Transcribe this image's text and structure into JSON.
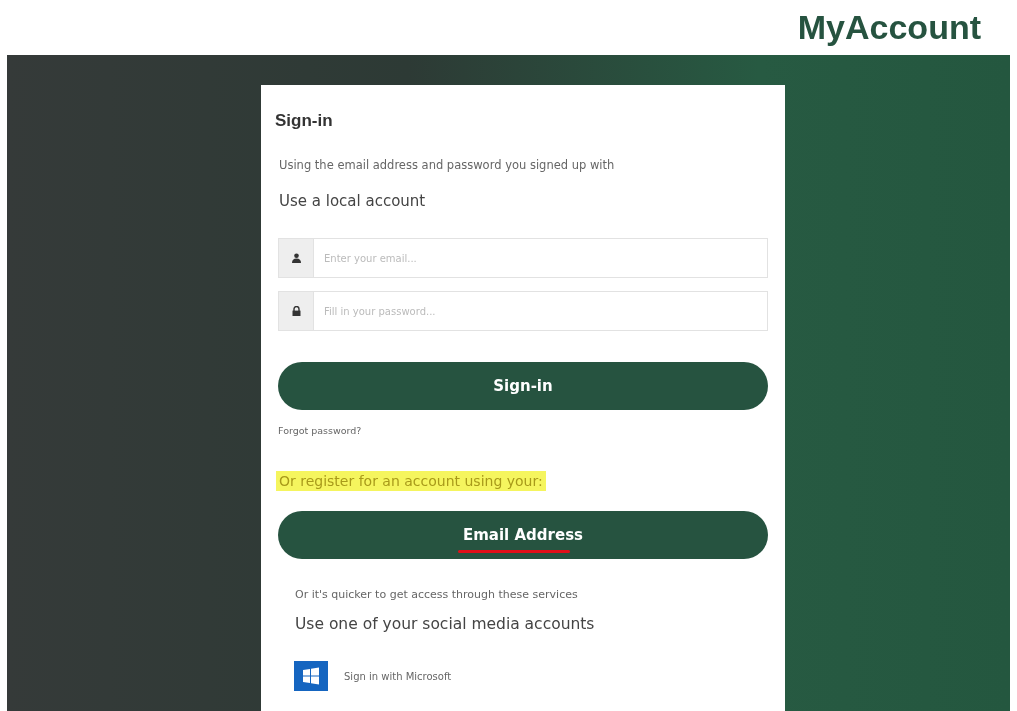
{
  "header": {
    "brand": "MyAccount"
  },
  "card": {
    "title": "Sign-in",
    "subtitle": "Using the email address and password you signed up with",
    "section": "Use a local account",
    "fields": [
      {
        "kind": "user",
        "placeholder": "Enter your email..."
      },
      {
        "kind": "lock",
        "placeholder": "Fill in your password..."
      }
    ],
    "sign_in_button": "Sign-in",
    "forgot_link": "Forgot password?",
    "register_prompt": {
      "text": "Or register for an account using your:",
      "highlighted": true
    },
    "email_button": {
      "label": "Email Address",
      "underlined": true
    },
    "services_note": "Or it's quicker to get access through these services",
    "social_heading": "Use one of your social media accounts",
    "social": [
      {
        "kind": "microsoft",
        "label": "Sign in with Microsoft"
      }
    ]
  }
}
